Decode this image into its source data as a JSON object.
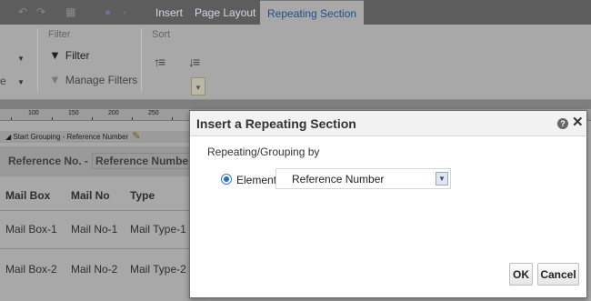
{
  "ribbon": {
    "tabs": [
      {
        "label": "Insert"
      },
      {
        "label": "Page Layout"
      },
      {
        "label": "Repeating Section"
      }
    ],
    "filter_group": {
      "title": "Filter",
      "filter_label": "Filter",
      "manage_filters_label": "Manage Filters"
    },
    "sort_group": {
      "title": "Sort"
    },
    "left_fragment": "e"
  },
  "ruler": {
    "labels": [
      "100",
      "150",
      "200",
      "250"
    ]
  },
  "document": {
    "grouping_label": "Start Grouping - Reference Number",
    "ref_label": "Reference No. -",
    "ref_field": "Reference Number",
    "headers": [
      "Mail Box",
      "Mail No",
      "Type"
    ],
    "rows": [
      [
        "Mail Box-1",
        "Mail No-1",
        "Mail Type-1"
      ],
      [
        "Mail Box-2",
        "Mail No-2",
        "Mail Type-2"
      ]
    ]
  },
  "dialog": {
    "title": "Insert a Repeating Section",
    "help_icon": "?",
    "close_icon": "✕",
    "grouping_label": "Repeating/Grouping by",
    "radio_label": "Element",
    "select_value": "Reference Number",
    "ok_label": "OK",
    "cancel_label": "Cancel"
  },
  "colors": {
    "active_tab_text": "#1f4e8c",
    "radio_accent": "#1a6fd0",
    "overlay": "#a8a8a8"
  }
}
